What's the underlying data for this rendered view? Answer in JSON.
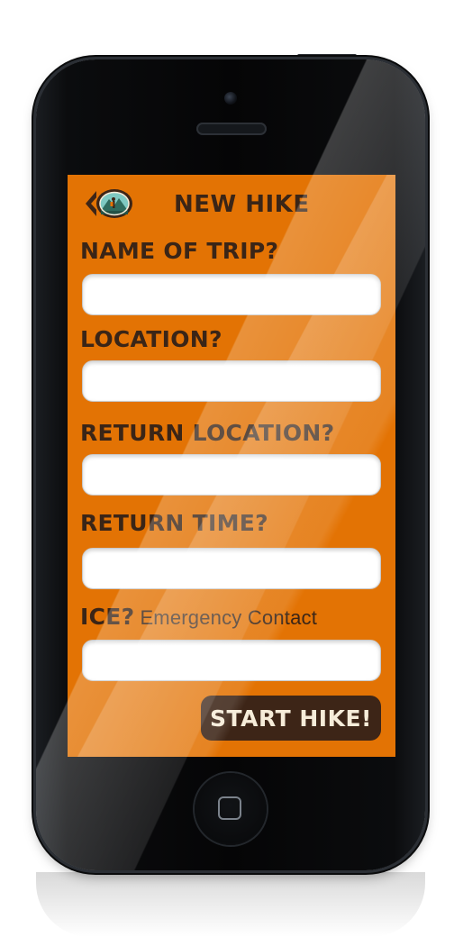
{
  "header": {
    "title": "NEW HIKE",
    "back_icon": "hiker-mountain-badge-icon"
  },
  "form": {
    "name_label": "NAME OF TRIP?",
    "name_value": "",
    "location_label": "LOCATION?",
    "location_value": "",
    "return_location_label": "RETURN LOCATION?",
    "return_location_value": "",
    "return_time_label": "RETURN TIME?",
    "return_time_value": "",
    "ice_label": "ICE?",
    "ice_sublabel": "Emergency Contact",
    "ice_value": ""
  },
  "actions": {
    "start_label": "START HIKE!"
  },
  "colors": {
    "screen_background": "#e37304",
    "label_text": "#3a2517",
    "button_background": "#3d2517",
    "button_text": "#f6ecd9"
  }
}
